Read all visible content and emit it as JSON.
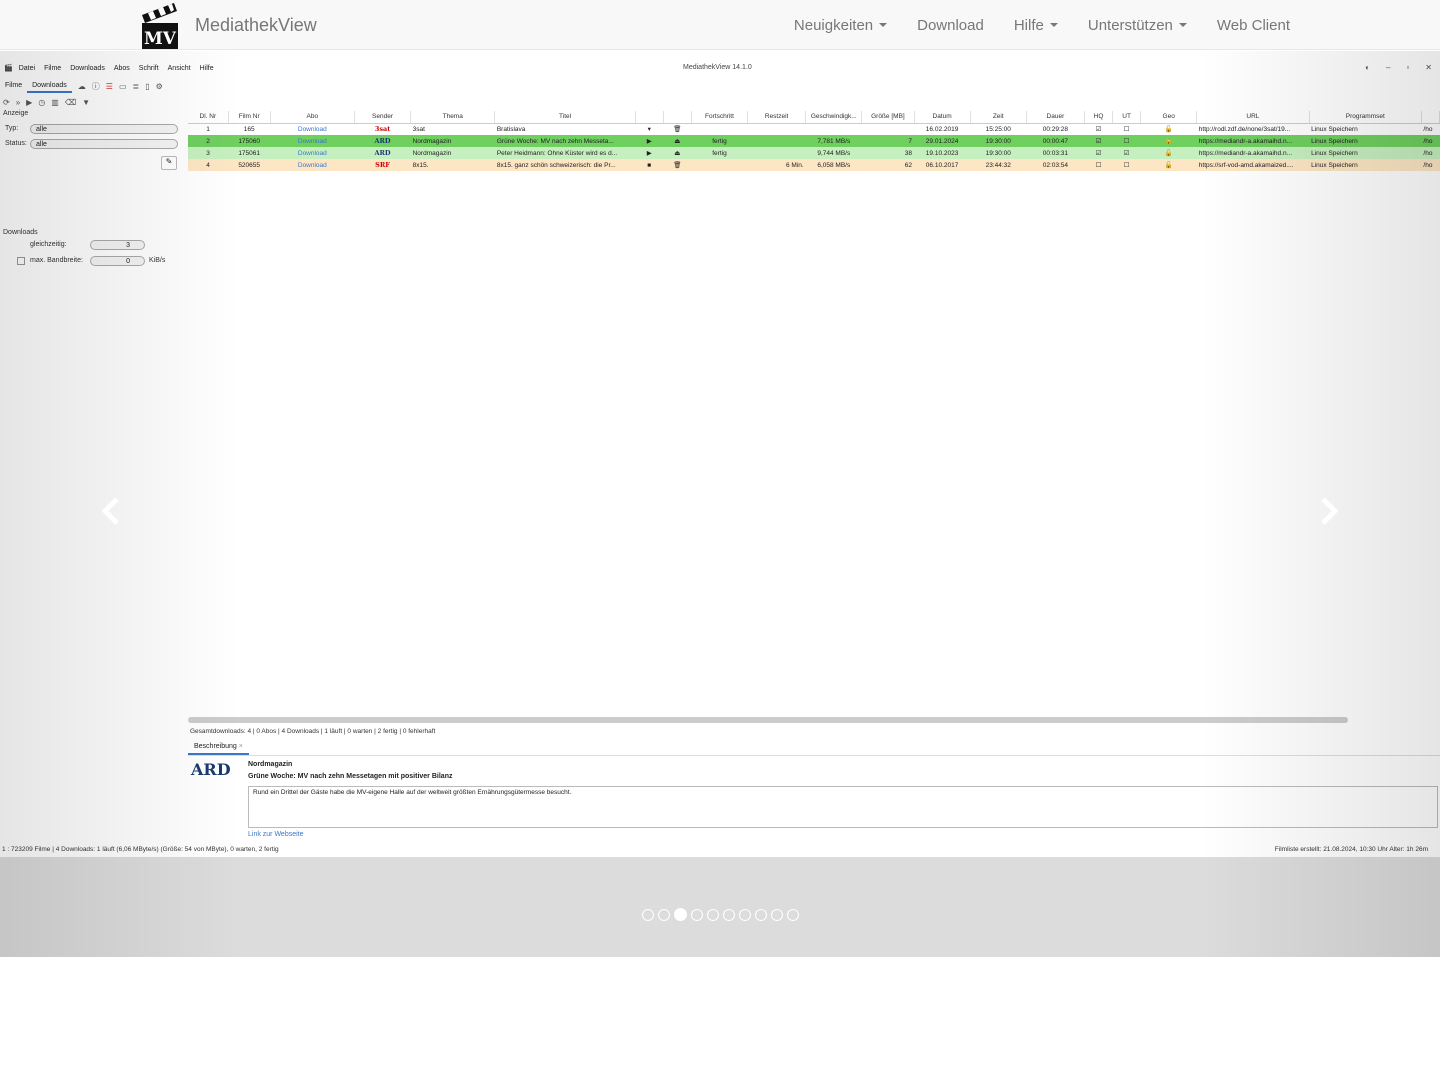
{
  "navbar": {
    "brand": "MediathekView",
    "logo_text": "MV",
    "items": [
      {
        "label": "Neuigkeiten",
        "dropdown": true
      },
      {
        "label": "Download",
        "dropdown": false
      },
      {
        "label": "Hilfe",
        "dropdown": true
      },
      {
        "label": "Unterstützen",
        "dropdown": true
      },
      {
        "label": "Web Client",
        "dropdown": false
      }
    ]
  },
  "carousel": {
    "slide_count": 10,
    "active_index": 2
  },
  "app": {
    "menu": [
      "Datei",
      "Filme",
      "Downloads",
      "Abos",
      "Schrift",
      "Ansicht",
      "Hilfe"
    ],
    "window_title": "MediathekView 14.1.0",
    "tabs": [
      "Filme",
      "Downloads"
    ],
    "active_tab": "Downloads",
    "side": {
      "anzeige_label": "Anzeige",
      "typ_label": "Typ:",
      "typ_value": "alle",
      "status_label": "Status:",
      "status_value": "alle",
      "downloads_label": "Downloads",
      "gleichzeitig_label": "gleichzeitig:",
      "gleichzeitig_value": "3",
      "bandbreite_label": "max. Bandbreite:",
      "bandbreite_value": "0",
      "bandbreite_unit": "KiB/s"
    },
    "columns": [
      "Dl. Nr",
      "Film Nr",
      "Abo",
      "Sender",
      "Thema",
      "Titel",
      "",
      "",
      "Fortschritt",
      "Restzeit",
      "Geschwindigk...",
      "Größe [MB]",
      "Datum",
      "Zeit",
      "Dauer",
      "HQ",
      "UT",
      "Geo",
      "URL",
      "Programmset",
      ""
    ],
    "rows": [
      {
        "dl": "1",
        "film": "165",
        "abo": "Download",
        "sender": "3sat",
        "thema": "3sat",
        "titel": "Bratislava",
        "fortschritt": "",
        "restzeit": "",
        "speed": "",
        "size": "",
        "datum": "16.02.2019",
        "zeit": "15:25:00",
        "dauer": "00:29:28",
        "hq": true,
        "ut": false,
        "url": "http://rodl.zdf.de/none/3sat/19...",
        "set": "Linux Speichern",
        "path": "/ho",
        "bg": "#ffffff"
      },
      {
        "dl": "2",
        "film": "175060",
        "abo": "Download",
        "sender": "ARD",
        "thema": "Nordmagazin",
        "titel": "Grüne Woche: MV nach zehn Messeta...",
        "fortschritt": "fertig",
        "restzeit": "",
        "speed": "7,781 MB/s",
        "size": "7",
        "datum": "29.01.2024",
        "zeit": "19:30:00",
        "dauer": "00:00:47",
        "hq": true,
        "ut": false,
        "url": "https://mediandr-a.akamaihd.n...",
        "set": "Linux Speichern",
        "path": "/ho",
        "bg": "#6fcf5f"
      },
      {
        "dl": "3",
        "film": "175061",
        "abo": "Download",
        "sender": "ARD",
        "thema": "Nordmagazin",
        "titel": "Peter Heidmann: Ohne Küster wird es d...",
        "fortschritt": "fertig",
        "restzeit": "",
        "speed": "9,744 MB/s",
        "size": "38",
        "datum": "19.10.2023",
        "zeit": "19:30:00",
        "dauer": "00:03:31",
        "hq": true,
        "ut": true,
        "url": "https://mediandr-a.akamaihd.n...",
        "set": "Linux Speichern",
        "path": "/ho",
        "bg": "#c6efbf"
      },
      {
        "dl": "4",
        "film": "520655",
        "abo": "Download",
        "sender": "SRF",
        "thema": "8x15.",
        "titel": "8x15. ganz schön schweizerisch: die Pr...",
        "fortschritt": "",
        "restzeit": "6 Min.",
        "speed": "6,058 MB/s",
        "size": "62",
        "datum": "06.10.2017",
        "zeit": "23:44:32",
        "dauer": "02:03:54",
        "hq": false,
        "ut": false,
        "url": "https://srf-vod-amd.akamaized....",
        "set": "Linux Speichern",
        "path": "/ho",
        "bg": "#fde6c4"
      }
    ],
    "summary": "Gesamtdownloads: 4 | 0 Abos | 4 Downloads | 1 läuft | 0 warten | 2 fertig | 0 fehlerhaft",
    "desc_tab": "Beschreibung",
    "desc_sender_logo": "ARD",
    "desc_thema": "Nordmagazin",
    "desc_title": "Grüne Woche: MV nach zehn Messetagen mit positiver Bilanz",
    "desc_text": "Rund ein Drittel der Gäste habe die MV-eigene Halle auf der weltweit größten Ernährungsgütermesse besucht.",
    "desc_link": "Link zur Webseite",
    "status_left": "1 : 723209 Filme | 4 Downloads: 1 läuft (6,06 MByte/s) (Größe: 54 von  MByte), 0 warten, 2 fertig",
    "status_right": "Filmliste erstellt: 21.08.2024, 10:30 Uhr  Alter: 1h 26m"
  }
}
